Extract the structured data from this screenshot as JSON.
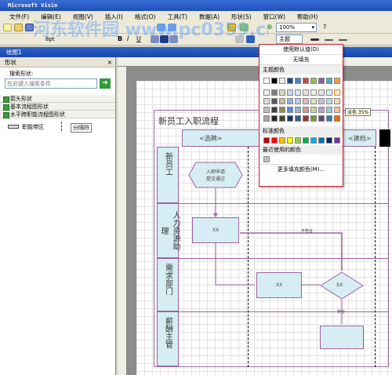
{
  "window": {
    "title": "Microsoft Visio"
  },
  "menu": [
    "文件(F)",
    "编辑(E)",
    "视图(V)",
    "插入(I)",
    "格式(O)",
    "工具(T)",
    "数据(A)",
    "形状(S)",
    "窗口(W)",
    "帮助(H)"
  ],
  "toolbar": {
    "zoom": "100%",
    "font_size": "8pt",
    "theme_label": "主题"
  },
  "document": {
    "title": "绘图1"
  },
  "shapes_pane": {
    "title": "形状",
    "search_label": "搜索形状:",
    "search_placeholder": "在此键入搜索条件",
    "stencils": [
      "箭头形状",
      "基本流程图形状",
      "水平跨职能流程图形状"
    ],
    "items": [
      "职能带区",
      "分隔符"
    ]
  },
  "fill_popup": {
    "use_default": "使用默认值(D)",
    "no_fill": "无填充",
    "theme_colors_label": "主题颜色",
    "standard_colors_label": "标准颜色",
    "recent_colors_label": "最近使用的颜色",
    "more_colors": "更多填充颜色(M)...",
    "tooltip": "淡色 35%",
    "theme_colors": [
      [
        "#ffffff",
        "#000000",
        "#eeece1",
        "#1f497d",
        "#4f81bd",
        "#c0504d",
        "#9bbb59",
        "#8064a2",
        "#4bacc6",
        "#f79646"
      ],
      [
        "#f2f2f2",
        "#7f7f7f",
        "#ddd9c3",
        "#c6d9f0",
        "#dbe5f1",
        "#f2dcdb",
        "#ebf1dd",
        "#e5e0ec",
        "#dbeef3",
        "#fdeada"
      ],
      [
        "#d8d8d8",
        "#595959",
        "#c4bd97",
        "#8db3e2",
        "#b8cce4",
        "#e5b9b7",
        "#d7e3bc",
        "#ccc1d9",
        "#b7dde8",
        "#fbd5b5"
      ],
      [
        "#bfbfbf",
        "#3f3f3f",
        "#938953",
        "#548dd4",
        "#95b3d7",
        "#d99694",
        "#c3d69b",
        "#b2a2c7",
        "#92cddc",
        "#fac08f"
      ],
      [
        "#a5a5a5",
        "#262626",
        "#494429",
        "#17365d",
        "#366092",
        "#953734",
        "#76923c",
        "#5f497a",
        "#31859b",
        "#e36c09"
      ]
    ],
    "standard_colors": [
      "#c00000",
      "#ff0000",
      "#ffc000",
      "#ffff00",
      "#92d050",
      "#00b050",
      "#00b0f0",
      "#0070c0",
      "#002060",
      "#7030a0"
    ],
    "recent_colors": [
      "#bfbfbf"
    ]
  },
  "diagram": {
    "title": "新员工入职流程",
    "phase1": "<选聘>",
    "phase2": "<建档>",
    "lanes": [
      "新员工",
      "人力资源助理",
      "需求部门",
      "薪酬主管"
    ],
    "start_shape": "入职申请\n提交通过",
    "box_xx": "XX",
    "connector_label": "不符合",
    "connector_label2": "符合"
  },
  "watermark": "河东软件园 www.pc0359.cn"
}
